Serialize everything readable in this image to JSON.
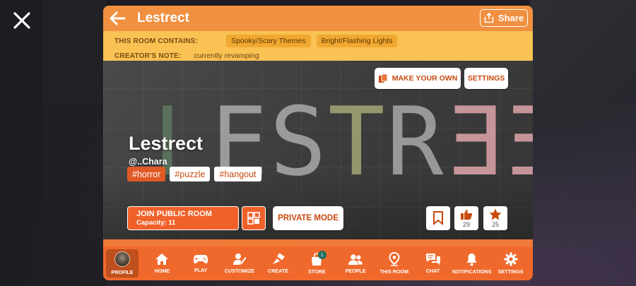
{
  "room": {
    "title": "Lestrect",
    "name": "Lestrect",
    "creator": "@..Chara",
    "tags": [
      "#horror",
      "#puzzle",
      "#hangout"
    ],
    "scene_sign": "LESTRƎƎT"
  },
  "header": {
    "share_label": "Share"
  },
  "info": {
    "contains_label": "THIS ROOM CONTAINS:",
    "contains": [
      "Spooky/Scary Themes",
      "Bright/Flashing Lights"
    ],
    "note_label": "CREATOR'S NOTE:",
    "note": "currently revamping"
  },
  "actions": {
    "make_your_own": "MAKE YOUR OWN",
    "settings": "SETTINGS",
    "join_label": "JOIN PUBLIC ROOM",
    "capacity": "Capacity: 11",
    "private_mode": "PRIVATE MODE",
    "likes": "29",
    "stars": "25"
  },
  "nav": {
    "items": [
      {
        "label": "PROFILE"
      },
      {
        "label": "HOME"
      },
      {
        "label": "PLAY"
      },
      {
        "label": "CUSTOMIZE"
      },
      {
        "label": "CREATE"
      },
      {
        "label": "STORE",
        "badge": "1"
      },
      {
        "label": "PEOPLE"
      },
      {
        "label": "THIS ROOM"
      },
      {
        "label": "CHAT"
      },
      {
        "label": "NOTIFICATIONS"
      },
      {
        "label": "SETTINGS"
      }
    ]
  },
  "colors": {
    "header": "#f09040",
    "info_band": "#f9c253",
    "accent": "#f0612a",
    "nav": "#f0692c"
  }
}
